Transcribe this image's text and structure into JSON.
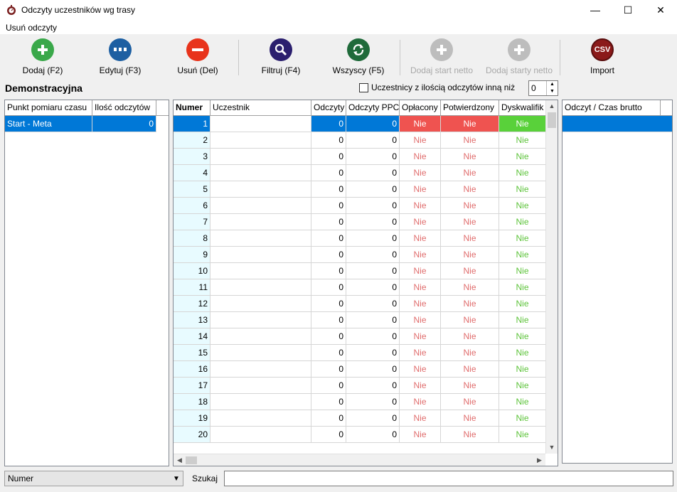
{
  "window": {
    "title": "Odczyty uczestników wg trasy",
    "minimize": "—",
    "maximize": "☐",
    "close": "✕"
  },
  "menu": {
    "item1": "Usuń odczyty"
  },
  "toolbar": {
    "add": "Dodaj (F2)",
    "edit": "Edytuj (F3)",
    "delete": "Usuń (Del)",
    "filter": "Filtruj (F4)",
    "all": "Wszyscy (F5)",
    "add_start_net": "Dodaj start netto",
    "add_starts_net": "Dodaj starty netto",
    "import": "Import",
    "import_icon_text": "CSV"
  },
  "colors": {
    "add": "#3aa84a",
    "edit": "#1d5fa2",
    "delete": "#e8331b",
    "filter": "#2b1f6e",
    "all": "#1f6a3a",
    "disabled": "#bdbdbd",
    "import": "#8b1a1a",
    "selection": "#0078d7"
  },
  "section": {
    "title": "Demonstracyjna",
    "filter_label": "Uczestnicy z ilością odczytów inną niż",
    "filter_value": "0"
  },
  "left_table": {
    "headers": [
      "Punkt pomiaru czasu",
      "Ilość odczytów"
    ],
    "rows": [
      [
        "Start - Meta",
        "0"
      ]
    ]
  },
  "main_table": {
    "headers": [
      "Numer",
      "Uczestnik",
      "Odczyty",
      "Odczyty PPC",
      "Opłacony",
      "Potwierdzony",
      "Dyskwalifik"
    ],
    "rows": [
      [
        "1",
        "",
        "0",
        "0",
        "Nie",
        "Nie",
        "Nie"
      ],
      [
        "2",
        "",
        "0",
        "0",
        "Nie",
        "Nie",
        "Nie"
      ],
      [
        "3",
        "",
        "0",
        "0",
        "Nie",
        "Nie",
        "Nie"
      ],
      [
        "4",
        "",
        "0",
        "0",
        "Nie",
        "Nie",
        "Nie"
      ],
      [
        "5",
        "",
        "0",
        "0",
        "Nie",
        "Nie",
        "Nie"
      ],
      [
        "6",
        "",
        "0",
        "0",
        "Nie",
        "Nie",
        "Nie"
      ],
      [
        "7",
        "",
        "0",
        "0",
        "Nie",
        "Nie",
        "Nie"
      ],
      [
        "8",
        "",
        "0",
        "0",
        "Nie",
        "Nie",
        "Nie"
      ],
      [
        "9",
        "",
        "0",
        "0",
        "Nie",
        "Nie",
        "Nie"
      ],
      [
        "10",
        "",
        "0",
        "0",
        "Nie",
        "Nie",
        "Nie"
      ],
      [
        "11",
        "",
        "0",
        "0",
        "Nie",
        "Nie",
        "Nie"
      ],
      [
        "12",
        "",
        "0",
        "0",
        "Nie",
        "Nie",
        "Nie"
      ],
      [
        "13",
        "",
        "0",
        "0",
        "Nie",
        "Nie",
        "Nie"
      ],
      [
        "14",
        "",
        "0",
        "0",
        "Nie",
        "Nie",
        "Nie"
      ],
      [
        "15",
        "",
        "0",
        "0",
        "Nie",
        "Nie",
        "Nie"
      ],
      [
        "16",
        "",
        "0",
        "0",
        "Nie",
        "Nie",
        "Nie"
      ],
      [
        "17",
        "",
        "0",
        "0",
        "Nie",
        "Nie",
        "Nie"
      ],
      [
        "18",
        "",
        "0",
        "0",
        "Nie",
        "Nie",
        "Nie"
      ],
      [
        "19",
        "",
        "0",
        "0",
        "Nie",
        "Nie",
        "Nie"
      ],
      [
        "20",
        "",
        "0",
        "0",
        "Nie",
        "Nie",
        "Nie"
      ]
    ]
  },
  "right_table": {
    "headers": [
      "Odczyt / Czas brutto"
    ]
  },
  "bottom": {
    "sort_value": "Numer",
    "search_label": "Szukaj",
    "search_value": ""
  }
}
